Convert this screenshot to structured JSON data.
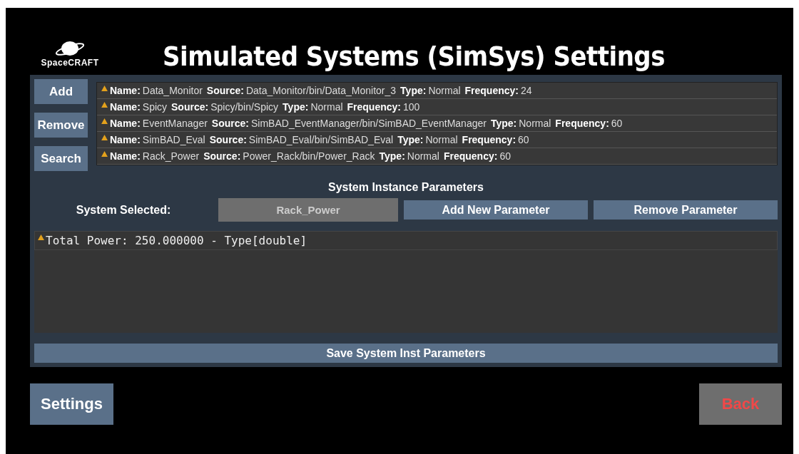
{
  "logo": {
    "text": "SpaceCRAFT"
  },
  "title": "Simulated Systems (SimSys) Settings",
  "side_buttons": [
    "Add",
    "Remove",
    "Search"
  ],
  "systems": [
    {
      "fields": [
        {
          "label": "Name:",
          "value": "Data_Monitor"
        },
        {
          "label": "Source:",
          "value": "Data_Monitor/bin/Data_Monitor_3"
        },
        {
          "label": "Type:",
          "value": "Normal"
        },
        {
          "label": "Frequency:",
          "value": "24"
        }
      ]
    },
    {
      "fields": [
        {
          "label": "Name:",
          "value": "Spicy"
        },
        {
          "label": "Source:",
          "value": "Spicy/bin/Spicy"
        },
        {
          "label": "Type:",
          "value": "Normal"
        },
        {
          "label": "Frequency:",
          "value": "100"
        }
      ]
    },
    {
      "fields": [
        {
          "label": "Name:",
          "value": "EventManager"
        },
        {
          "label": "Source:",
          "value": "SimBAD_EventManager/bin/SimBAD_EventManager"
        },
        {
          "label": "Type:",
          "value": "Normal"
        },
        {
          "label": "Frequency:",
          "value": "60"
        }
      ]
    },
    {
      "fields": [
        {
          "label": "Name:",
          "value": "SimBAD_Eval"
        },
        {
          "label": "Source:",
          "value": "SimBAD_Eval/bin/SimBAD_Eval"
        },
        {
          "label": "Type:",
          "value": "Normal"
        },
        {
          "label": "Frequency:",
          "value": "60"
        }
      ]
    },
    {
      "fields": [
        {
          "label": "Name:",
          "value": "Rack_Power"
        },
        {
          "label": "Source:",
          "value": "Power_Rack/bin/Power_Rack"
        },
        {
          "label": "Type:",
          "value": "Normal"
        },
        {
          "label": "Frequency:",
          "value": "60"
        }
      ]
    }
  ],
  "section_title": "System Instance Parameters",
  "system_selected": {
    "label": "System Selected:",
    "value": "Rack_Power",
    "disabled": true
  },
  "param_buttons": [
    "Add New Parameter",
    "Remove Parameter"
  ],
  "parameters": [
    "Total Power: 250.000000 - Type[double]"
  ],
  "save_button": "Save System Inst Parameters",
  "footer": {
    "settings": "Settings",
    "back": "Back"
  }
}
